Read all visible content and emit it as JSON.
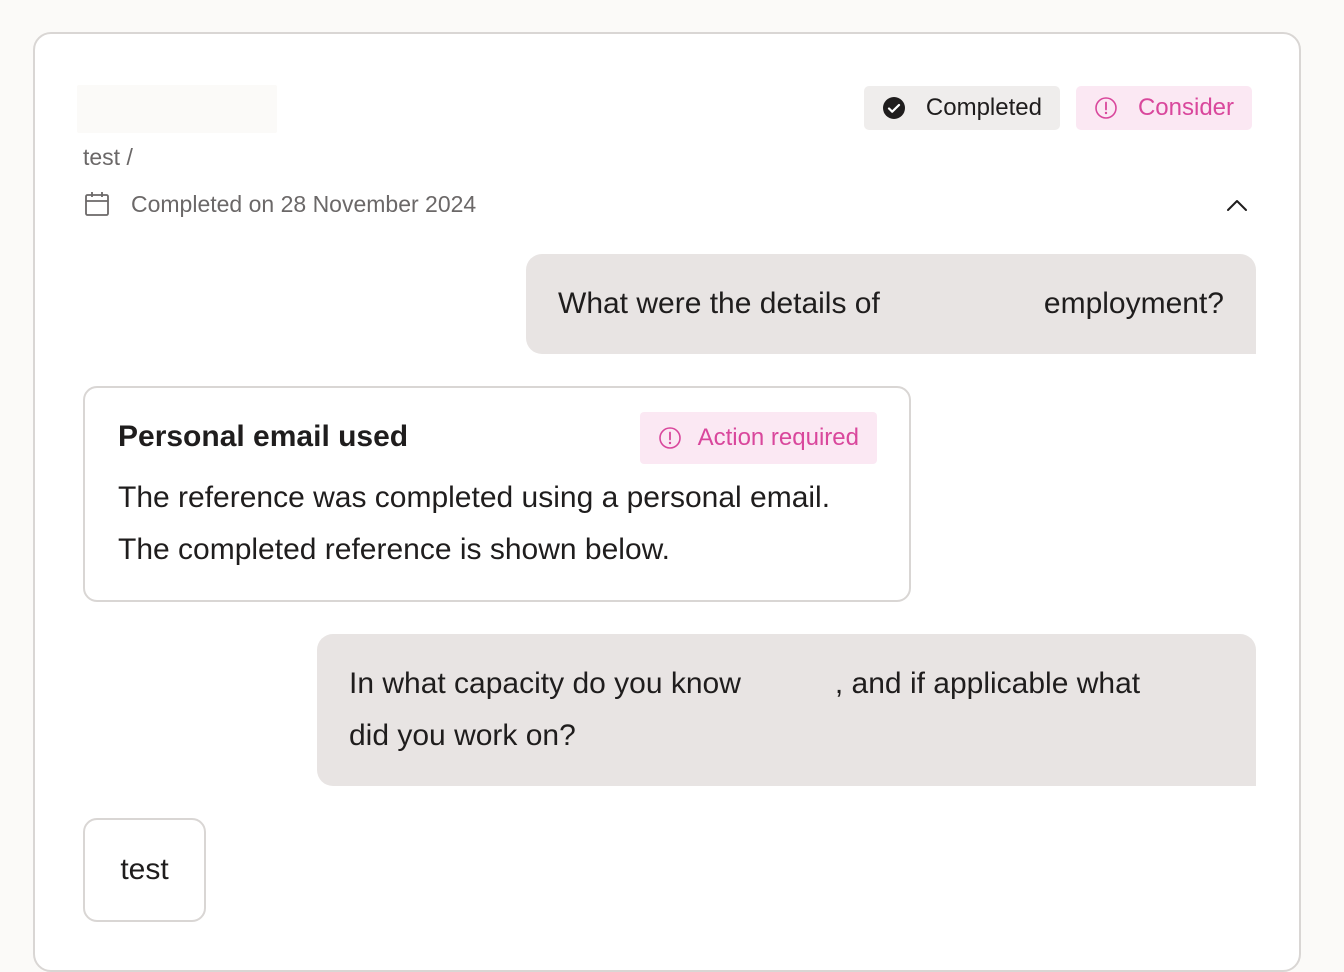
{
  "header": {
    "status_completed": "Completed",
    "status_consider": "Consider",
    "breadcrumb": "test /",
    "completed_date": "Completed on 28 November 2024"
  },
  "questions": [
    {
      "text_start": "What were the details of",
      "text_end": "employment?"
    },
    {
      "line1_start": "In what capacity do you know",
      "line1_end": ", and if applicable what",
      "line2": "did you work on?"
    }
  ],
  "flag": {
    "title": "Personal email used",
    "badge": "Action required",
    "body_line1": "The reference was completed using a personal email.",
    "body_line2": "The completed reference is shown below."
  },
  "answer": {
    "text": "test"
  },
  "colors": {
    "accent_pink": "#d9479c",
    "pink_bg": "#fbe8f3",
    "question_bg": "#e8e4e3",
    "text_dark": "#1f1d1d",
    "text_muted": "#6b6868"
  },
  "icons": [
    "check-circle-icon",
    "alert-circle-icon",
    "calendar-icon",
    "chevron-up-icon"
  ]
}
